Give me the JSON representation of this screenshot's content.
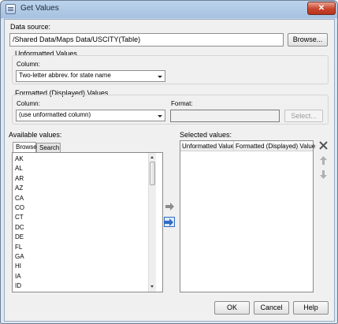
{
  "window": {
    "title": "Get Values",
    "close_label": "✕"
  },
  "data_source": {
    "label": "Data source:",
    "value": "/Shared Data/Maps Data/USCITY(Table)",
    "browse_label": "Browse..."
  },
  "unformatted": {
    "group_label": "Unformatted Values",
    "column_label": "Column:",
    "column_value": "Two-letter abbrev. for state name"
  },
  "formatted": {
    "group_label": "Formatted (Displayed) Values",
    "column_label": "Column:",
    "column_value": "(use unformatted column)",
    "format_label": "Format:",
    "format_value": "",
    "select_label": "Select..."
  },
  "available": {
    "label": "Available values:",
    "tabs": [
      "Browse",
      "Search"
    ],
    "items": [
      "AK",
      "AL",
      "AR",
      "AZ",
      "CA",
      "CO",
      "CT",
      "DC",
      "DE",
      "FL",
      "GA",
      "HI",
      "IA",
      "ID"
    ],
    "scroll_position": 0.0
  },
  "selected": {
    "label": "Selected values:",
    "columns": [
      "Unformatted Value",
      "Formatted (Displayed) Value"
    ],
    "rows": []
  },
  "footer": {
    "ok_label": "OK",
    "cancel_label": "Cancel",
    "help_label": "Help"
  },
  "colors": {
    "add_arrow": "#8c8c8c",
    "add_all_arrow": "#2f6cc4",
    "remove": "#555555"
  },
  "icons": [
    "add-arrow-icon",
    "add-all-icon",
    "remove-x-icon",
    "move-up-icon",
    "move-down-icon"
  ]
}
